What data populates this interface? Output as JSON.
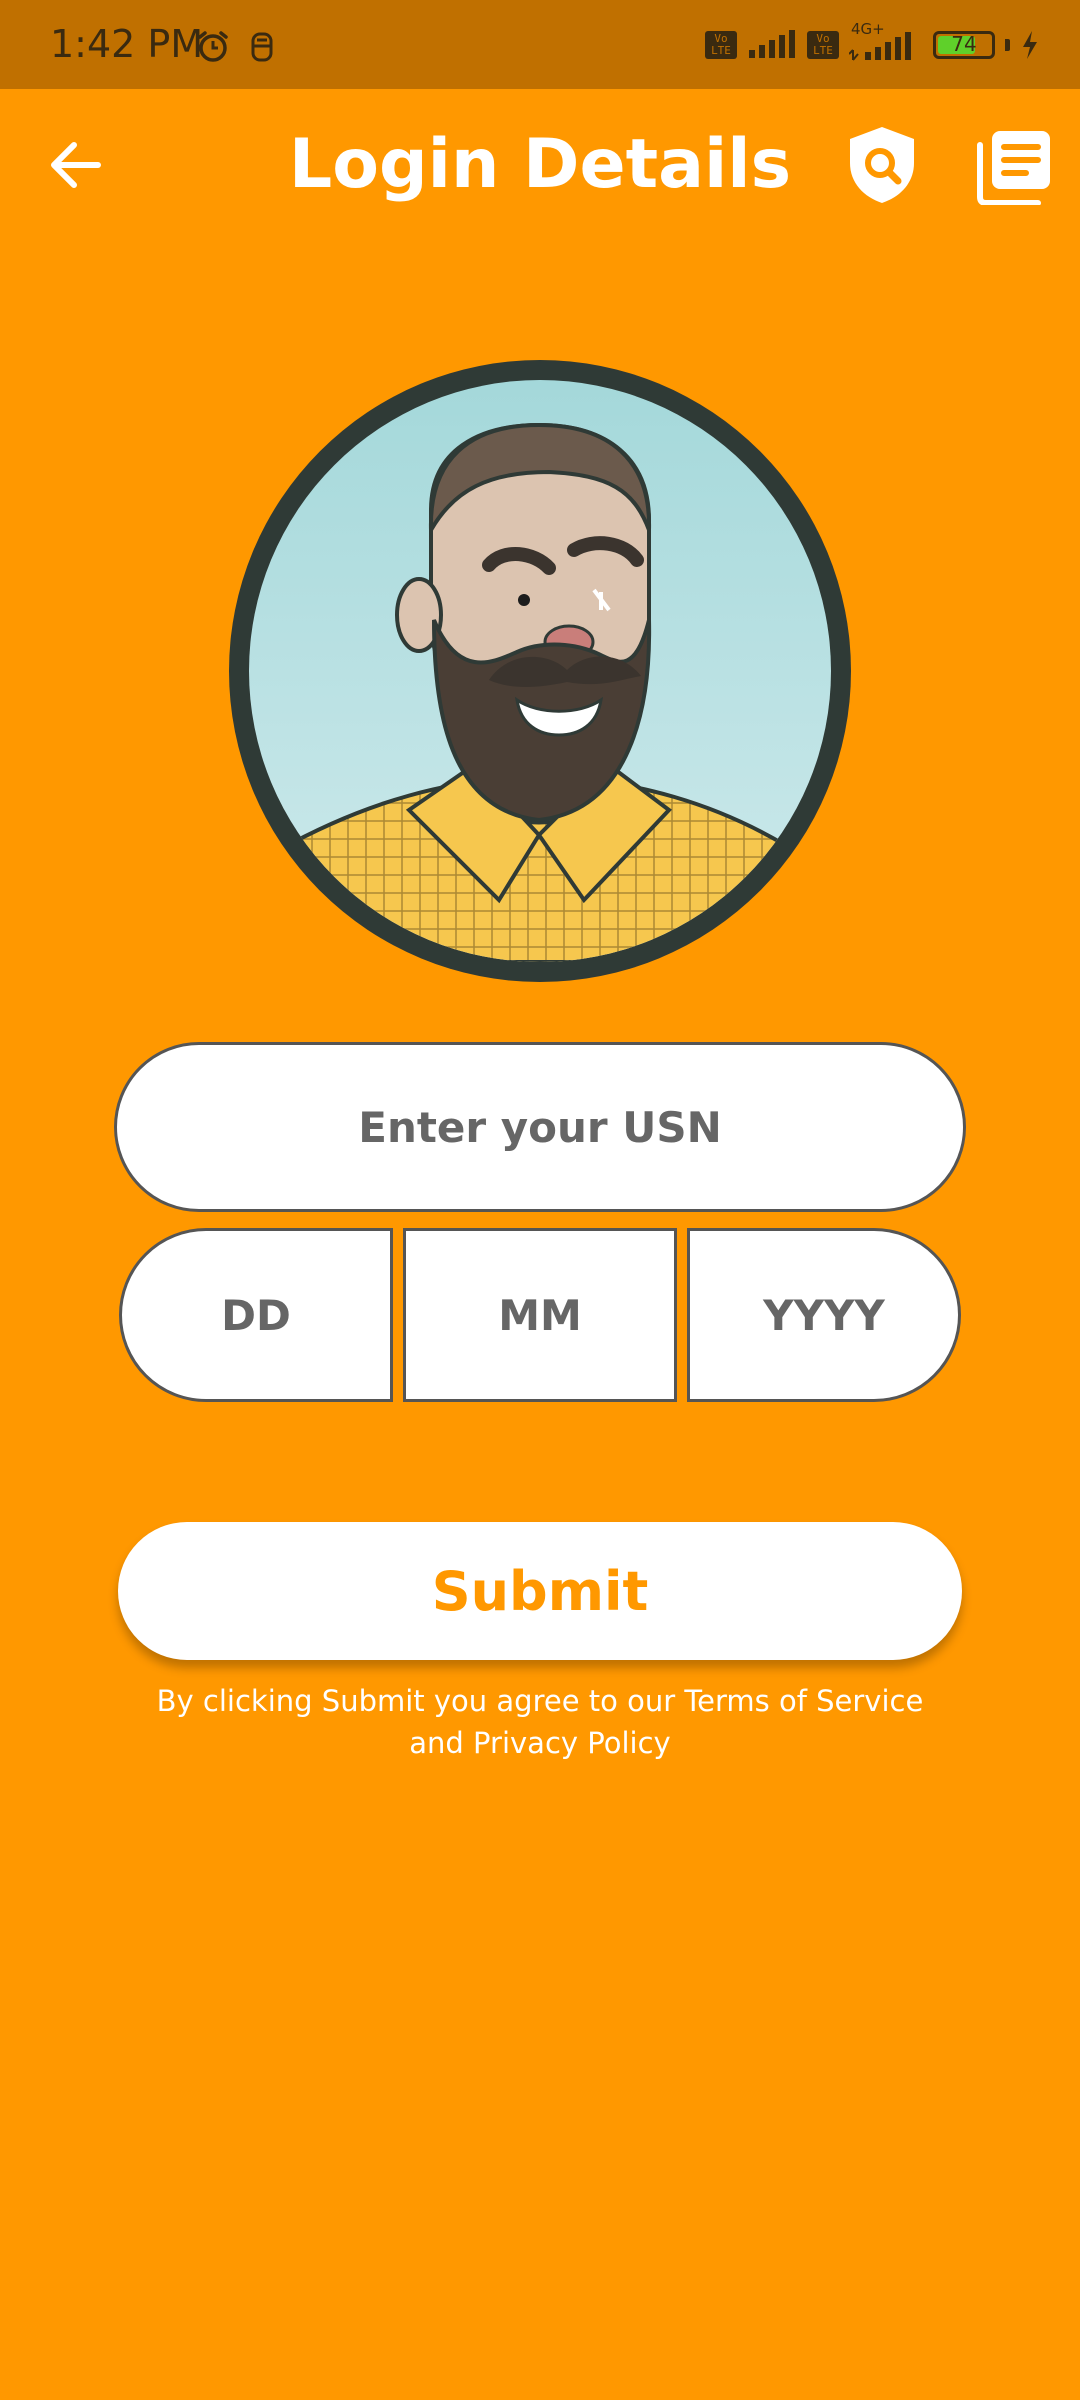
{
  "status_bar": {
    "time": "1:42 PM",
    "network_label": "4G+",
    "vo_label": "Vo LTE",
    "battery_level": "74",
    "battery_fraction": 0.74
  },
  "header": {
    "title": "Login Details",
    "back_icon": "arrow-left-icon",
    "privacy_icon": "shield-search-icon",
    "docs_icon": "document-list-icon"
  },
  "form": {
    "usn_placeholder": "Enter your USN",
    "dd_placeholder": "DD",
    "mm_placeholder": "MM",
    "yyyy_placeholder": "YYYY",
    "submit_label": "Submit",
    "terms_line1": "By clicking Submit you agree to our Terms of Service",
    "terms_line2": "and Privacy Policy"
  },
  "colors": {
    "background": "#FF9800",
    "status_bar": "#C07000",
    "accent": "#FF9800",
    "avatar_border": "#2f3a36",
    "avatar_sky": "#A8DADC"
  }
}
